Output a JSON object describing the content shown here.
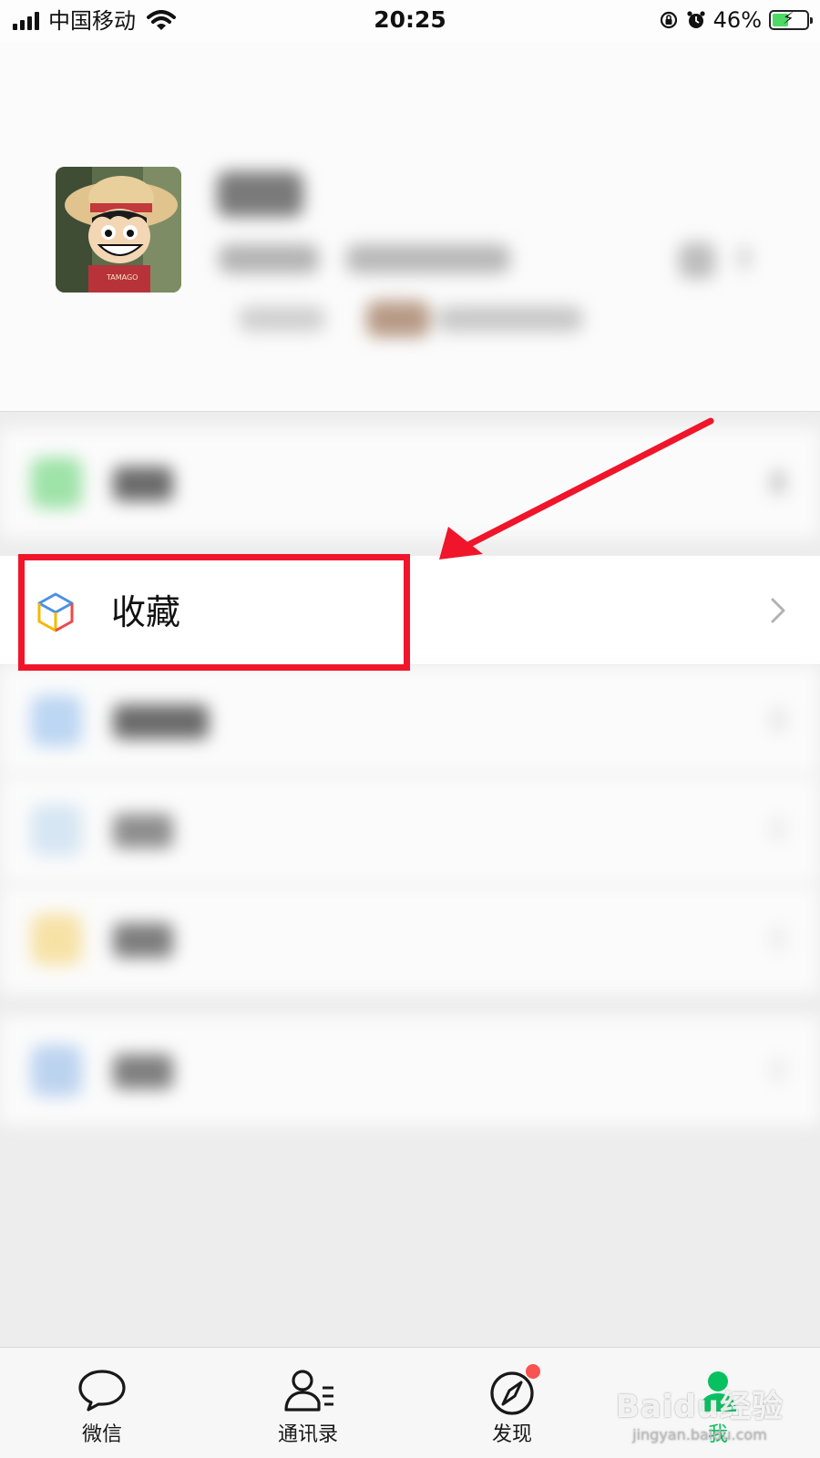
{
  "status_bar": {
    "carrier": "中国移动",
    "time": "20:25",
    "battery_percent": "46%",
    "battery_level": 0.46,
    "icons": [
      "signal-icon",
      "wifi-icon",
      "rotation-lock-icon",
      "alarm-icon",
      "battery-icon"
    ]
  },
  "menu": {
    "favorites_label": "收藏",
    "favorites_icon": "cube-icon"
  },
  "tabbar": {
    "tabs": [
      {
        "label": "微信",
        "icon": "chat-bubble-icon"
      },
      {
        "label": "通讯录",
        "icon": "contacts-icon"
      },
      {
        "label": "发现",
        "icon": "compass-icon"
      },
      {
        "label": "我",
        "icon": "me-icon"
      }
    ],
    "active_color": "#07c160"
  },
  "annotation": {
    "highlight_color": "#f0152a"
  },
  "watermark": {
    "main": "Baidu经验",
    "sub": "jingyan.baidu.com"
  }
}
